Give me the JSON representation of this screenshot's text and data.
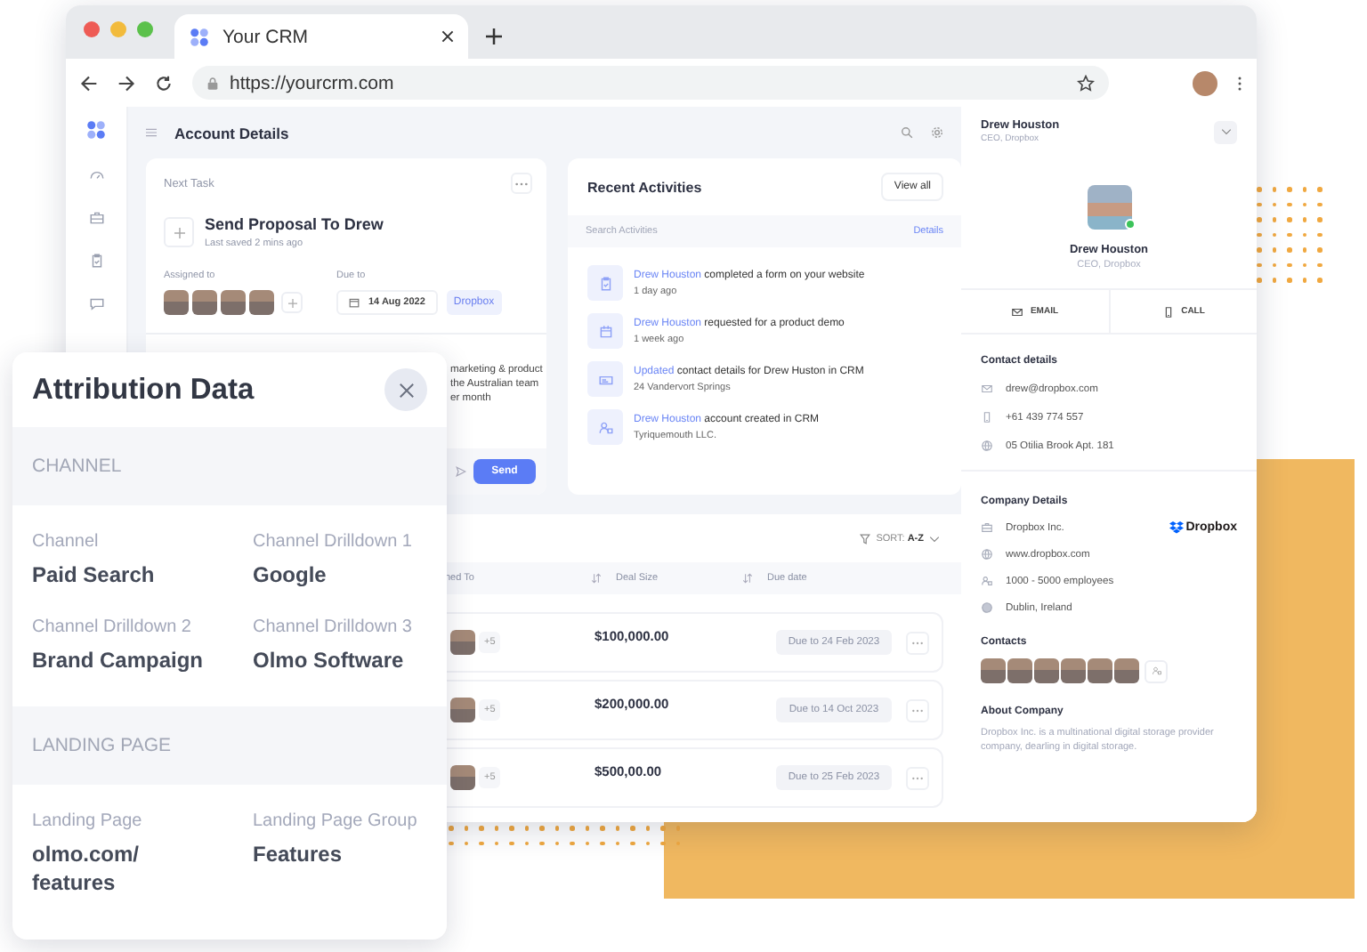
{
  "browser": {
    "tab_title": "Your CRM",
    "url": "https://yourcrm.com"
  },
  "page_title": "Account Details",
  "next_task": {
    "heading": "Next Task",
    "title": "Send Proposal To Drew",
    "saved": "Last saved  2 mins ago",
    "assigned_label": "Assigned to",
    "due_label": "Due to",
    "due_date": "14 Aug 2022",
    "tag": "Dropbox",
    "note_lines": [
      "marketing & product",
      "the Australian team",
      "er month"
    ],
    "send_label": "Send"
  },
  "recent_activities": {
    "title": "Recent Activities",
    "view_all": "View all",
    "search_placeholder": "Search Activities",
    "details_link": "Details",
    "items": [
      {
        "kind": "form",
        "link": "Drew Houston",
        "text": "completed a form on your website",
        "detail": "1 day ago"
      },
      {
        "kind": "demo",
        "link": "Drew Houston",
        "text": "requested for a product demo",
        "detail": "1 week ago"
      },
      {
        "kind": "update",
        "link": "Updated",
        "text": "contact details for Drew Huston in CRM",
        "detail": "24 Vandervort Springs"
      },
      {
        "kind": "account",
        "link": "Drew Houston",
        "text": "account created in CRM",
        "detail": "Tyriquemouth LLC."
      }
    ]
  },
  "deals": {
    "sort_text": "SORT: **A-Z**",
    "columns": [
      "ned To",
      "Deal Size",
      "Due date"
    ],
    "rows": [
      {
        "extra": "+5",
        "amount": "$100,000.00",
        "due": "Due to 24 Feb 2023"
      },
      {
        "extra": "+5",
        "amount": "$200,000.00",
        "due": "Due to 14 Oct 2023"
      },
      {
        "extra": "+5",
        "amount": "$500,00.00",
        "due": "Due to 25 Feb 2023"
      }
    ]
  },
  "contact": {
    "header_name": "Drew Houston",
    "header_role": "CEO, Dropbox",
    "name": "Drew Houston",
    "role": "CEO, Dropbox",
    "online": true,
    "actions": [
      {
        "kind": "mail",
        "label": "EMAIL"
      },
      {
        "kind": "phone",
        "label": "CALL"
      }
    ],
    "contact_heading": "Contact details",
    "contact_items": [
      {
        "kind": "mail",
        "text": "drew@dropbox.com"
      },
      {
        "kind": "phone",
        "text": "+61  439 774 557"
      },
      {
        "kind": "globe",
        "text": "05 Otilia Brook Apt. 181"
      }
    ],
    "company_heading": "Company Details",
    "company_logo": "Dropbox",
    "company_items": [
      {
        "kind": "briefcase",
        "text": "Dropbox Inc."
      },
      {
        "kind": "globe",
        "text": "www.dropbox.com"
      },
      {
        "kind": "people",
        "text": "1000 - 5000 employees"
      },
      {
        "kind": "dot",
        "text": "Dublin, Ireland"
      }
    ],
    "contacts_heading": "Contacts",
    "about_heading": "About Company",
    "about_text": "Dropbox Inc. is a multinational digital storage provider company, dearling in digital storage."
  },
  "attribution": {
    "title": "Attribution Data",
    "sections": [
      {
        "heading": "CHANNEL",
        "fields": [
          {
            "label": "Channel",
            "value": "Paid Search"
          },
          {
            "label": "Channel Drilldown 1",
            "value": "Google"
          },
          {
            "label": "Channel Drilldown 2",
            "value": "Brand Campaign"
          },
          {
            "label": "Channel Drilldown 3",
            "value": "Olmo Software"
          }
        ]
      },
      {
        "heading": "LANDING PAGE",
        "fields": [
          {
            "label": "Landing Page",
            "value": "olmo.com/features"
          },
          {
            "label": "Landing Page Group",
            "value": "Features"
          }
        ]
      }
    ]
  }
}
